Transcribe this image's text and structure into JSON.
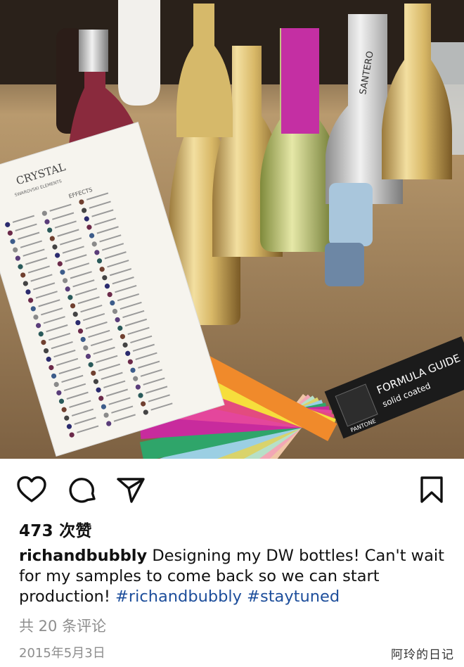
{
  "post": {
    "likes": "473 次赞",
    "username": "richandbubbly",
    "caption_text": "Designing my DW bottles! Can't wait for my samples to come back so we can start production!",
    "hashtags": [
      "#richandbubbly",
      "#staytuned"
    ],
    "view_comments": "共 20 条评论",
    "date": "2015年5月3日"
  },
  "actions": {
    "like_icon": "heart-outline-icon",
    "comment_icon": "speech-bubble-icon",
    "share_icon": "paper-plane-icon",
    "save_icon": "bookmark-icon"
  },
  "photo": {
    "card_brand": "CRYSTAL",
    "card_subtitle": "SWAROVSKI ELEMENTS",
    "card_heading": "EFFECTS",
    "bottle_label": "SANTERO",
    "guide_title": "FORMULA GUIDE",
    "guide_subtitle": "solid coated",
    "guide_brand": "PANTONE"
  },
  "watermark": "阿玲的日记",
  "colors": {
    "hashtag": "#1d4e9b",
    "muted": "#8e8e8e",
    "text": "#111111"
  }
}
